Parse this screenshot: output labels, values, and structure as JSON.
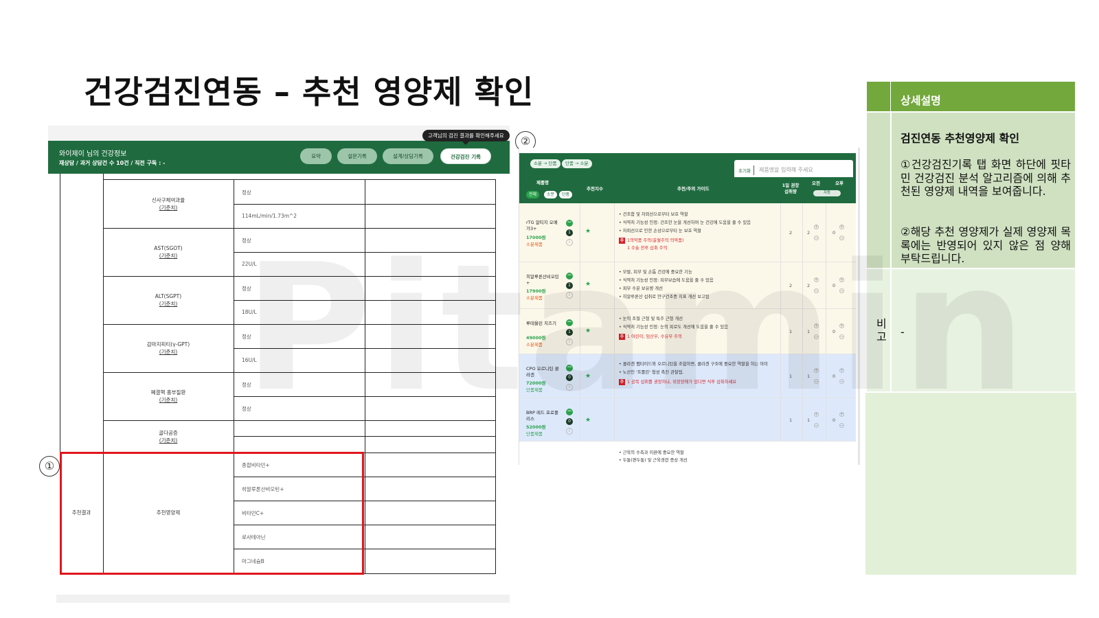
{
  "slide": {
    "title": "건강검진연동 – 추천 영양제 확인",
    "marker1": "①",
    "marker2": "②",
    "watermark": "Pitamin"
  },
  "left": {
    "tooltip": "고객님의 검진 결과를 확인해주세요",
    "header_name": "와이제이 님의 건강정보",
    "header_sub": "재상담 / 과거 상담건 수 10건 / 직전 구독 : -",
    "tabs": [
      "요약",
      "설문기록",
      "설계/상담기록",
      "건강검진 기록"
    ],
    "std_label": "(기준치)",
    "rows": [
      {
        "label": "신사구체여과율",
        "values": [
          "정상",
          "114mL/min/1.73m^2"
        ]
      },
      {
        "label": "AST(SGOT)",
        "values": [
          "정상",
          "22U/L"
        ]
      },
      {
        "label": "ALT(SGPT)",
        "values": [
          "정상",
          "18U/L"
        ]
      },
      {
        "label": "감마지피티(γ-GPT)",
        "values": [
          "정상",
          "16U/L"
        ]
      },
      {
        "label": "폐결핵 흉부질환",
        "values": [
          "정상",
          "정상"
        ]
      },
      {
        "label": "골다공증",
        "values": [
          "",
          ""
        ]
      }
    ],
    "rec_group": "추천결과",
    "rec_label": "추천영양제",
    "rec_items": [
      "종합비타민+",
      "히알루론산비오틴+",
      "비타민C+",
      "로사테아닌",
      "마그네슘B"
    ]
  },
  "mid": {
    "pills": [
      "소분 → 단품",
      "단품 → 소분"
    ],
    "search_reset": "초기화",
    "search_placeholder": "제품명을 입력해 주세요",
    "head": {
      "name": "제품명",
      "recommend": "추천지수",
      "guide": "추천/주의 가이드",
      "daily": "1일 권장\n섭취량",
      "am": "오전",
      "pm": "오후",
      "filters": [
        "전체",
        "소분",
        "단품"
      ],
      "time_select": "자동"
    },
    "products": [
      {
        "name": "rTG 알티지 오메\n가3+",
        "price": "17000원",
        "type": "소분제품",
        "rank": "1",
        "guide": [
          "건조함 및 자외선으로부터 보호 역할",
          "식약처 기능성 인정: 건조한 눈을 개선하여 눈 건강에 도움을 줄 수 있음",
          "자외선으로 인한 손상으로부터 눈 보호 역할"
        ],
        "warn": "1의약품 주의(출혈주의 의약품)",
        "warn2": "1 수술 전후 섭취 주의",
        "daily": "2",
        "am": "2",
        "pm": "0"
      },
      {
        "name": "히알루론산비오틴\n+",
        "price": "17900원",
        "type": "소분제품",
        "rank": "1",
        "guide": [
          "모발, 피부 및 손톱 건강에 중요한 기능",
          "식약처 기능성 인정: 피부보습에 도움을 줄 수 있음",
          "피부 수분 보유량 개선",
          "히알루론산 섭취로 안구건조증 지표 개선 보고됨"
        ],
        "warn": "",
        "warn2": "",
        "daily": "2",
        "am": "2",
        "pm": "0"
      },
      {
        "name": "루테올린 치즈기",
        "price": "49000원",
        "type": "소분제품",
        "rank": "1",
        "guide": [
          "눈의 조절 근형 및 특주 근형 개선",
          "식약처 기능성 인정: 눈의 피로도 개선에 도움을 줄 수 있음"
        ],
        "warn": "1 어린이, 임산부, 수유부 주의",
        "warn2": "",
        "daily": "1",
        "am": "1",
        "pm": "0"
      },
      {
        "name": "CPO 오르니틴 콜\n라겐",
        "price": "72000원",
        "type": "단품제품",
        "rank": "0",
        "guide": [
          "콜라겐 펩타이드와 오르니틴을 조합하면, 콜라겐 구조에 중요한 역할을 하는 아미",
          "노산인 '프롤린' 형성 촉진 관찰됨."
        ],
        "warn": "1 공복 섭취를 권장하나, 위장장애가 있다면 식후 섭취하세요",
        "warn2": "",
        "daily": "1",
        "am": "1",
        "pm": "0"
      },
      {
        "name": "BRP 레드 프로폴\n리스",
        "price": "52000원",
        "type": "단품제품",
        "rank": "0",
        "guide": [],
        "warn": "",
        "warn2": "",
        "daily": "1",
        "am": "1",
        "pm": "0"
      }
    ],
    "tail_guide": [
      "근육의 수축과 이완에 중요한 역할",
      "두통(편두통) 및 근육경련 증상 개선"
    ]
  },
  "right": {
    "head": "상세설명",
    "title": "검진연동 추천영양제 확인",
    "p1": "①건강검진기록 탭 화면 하단에 핏타민 건강검진 분석 알고리즘에 의해 추천된 영양제 내역을 보여줍니다.",
    "p2": "②해당 추천 영양제가 실제 영양제 목록에는 반영되어 있지 않은 점 양해 부탁드립니다.",
    "note_label": "비고",
    "note_value": "-"
  },
  "colors": {
    "brand_green": "#1f6b3f",
    "accent_green": "#2ba24c",
    "highlight_red": "#e0141b",
    "panel_head": "#72a83c"
  }
}
